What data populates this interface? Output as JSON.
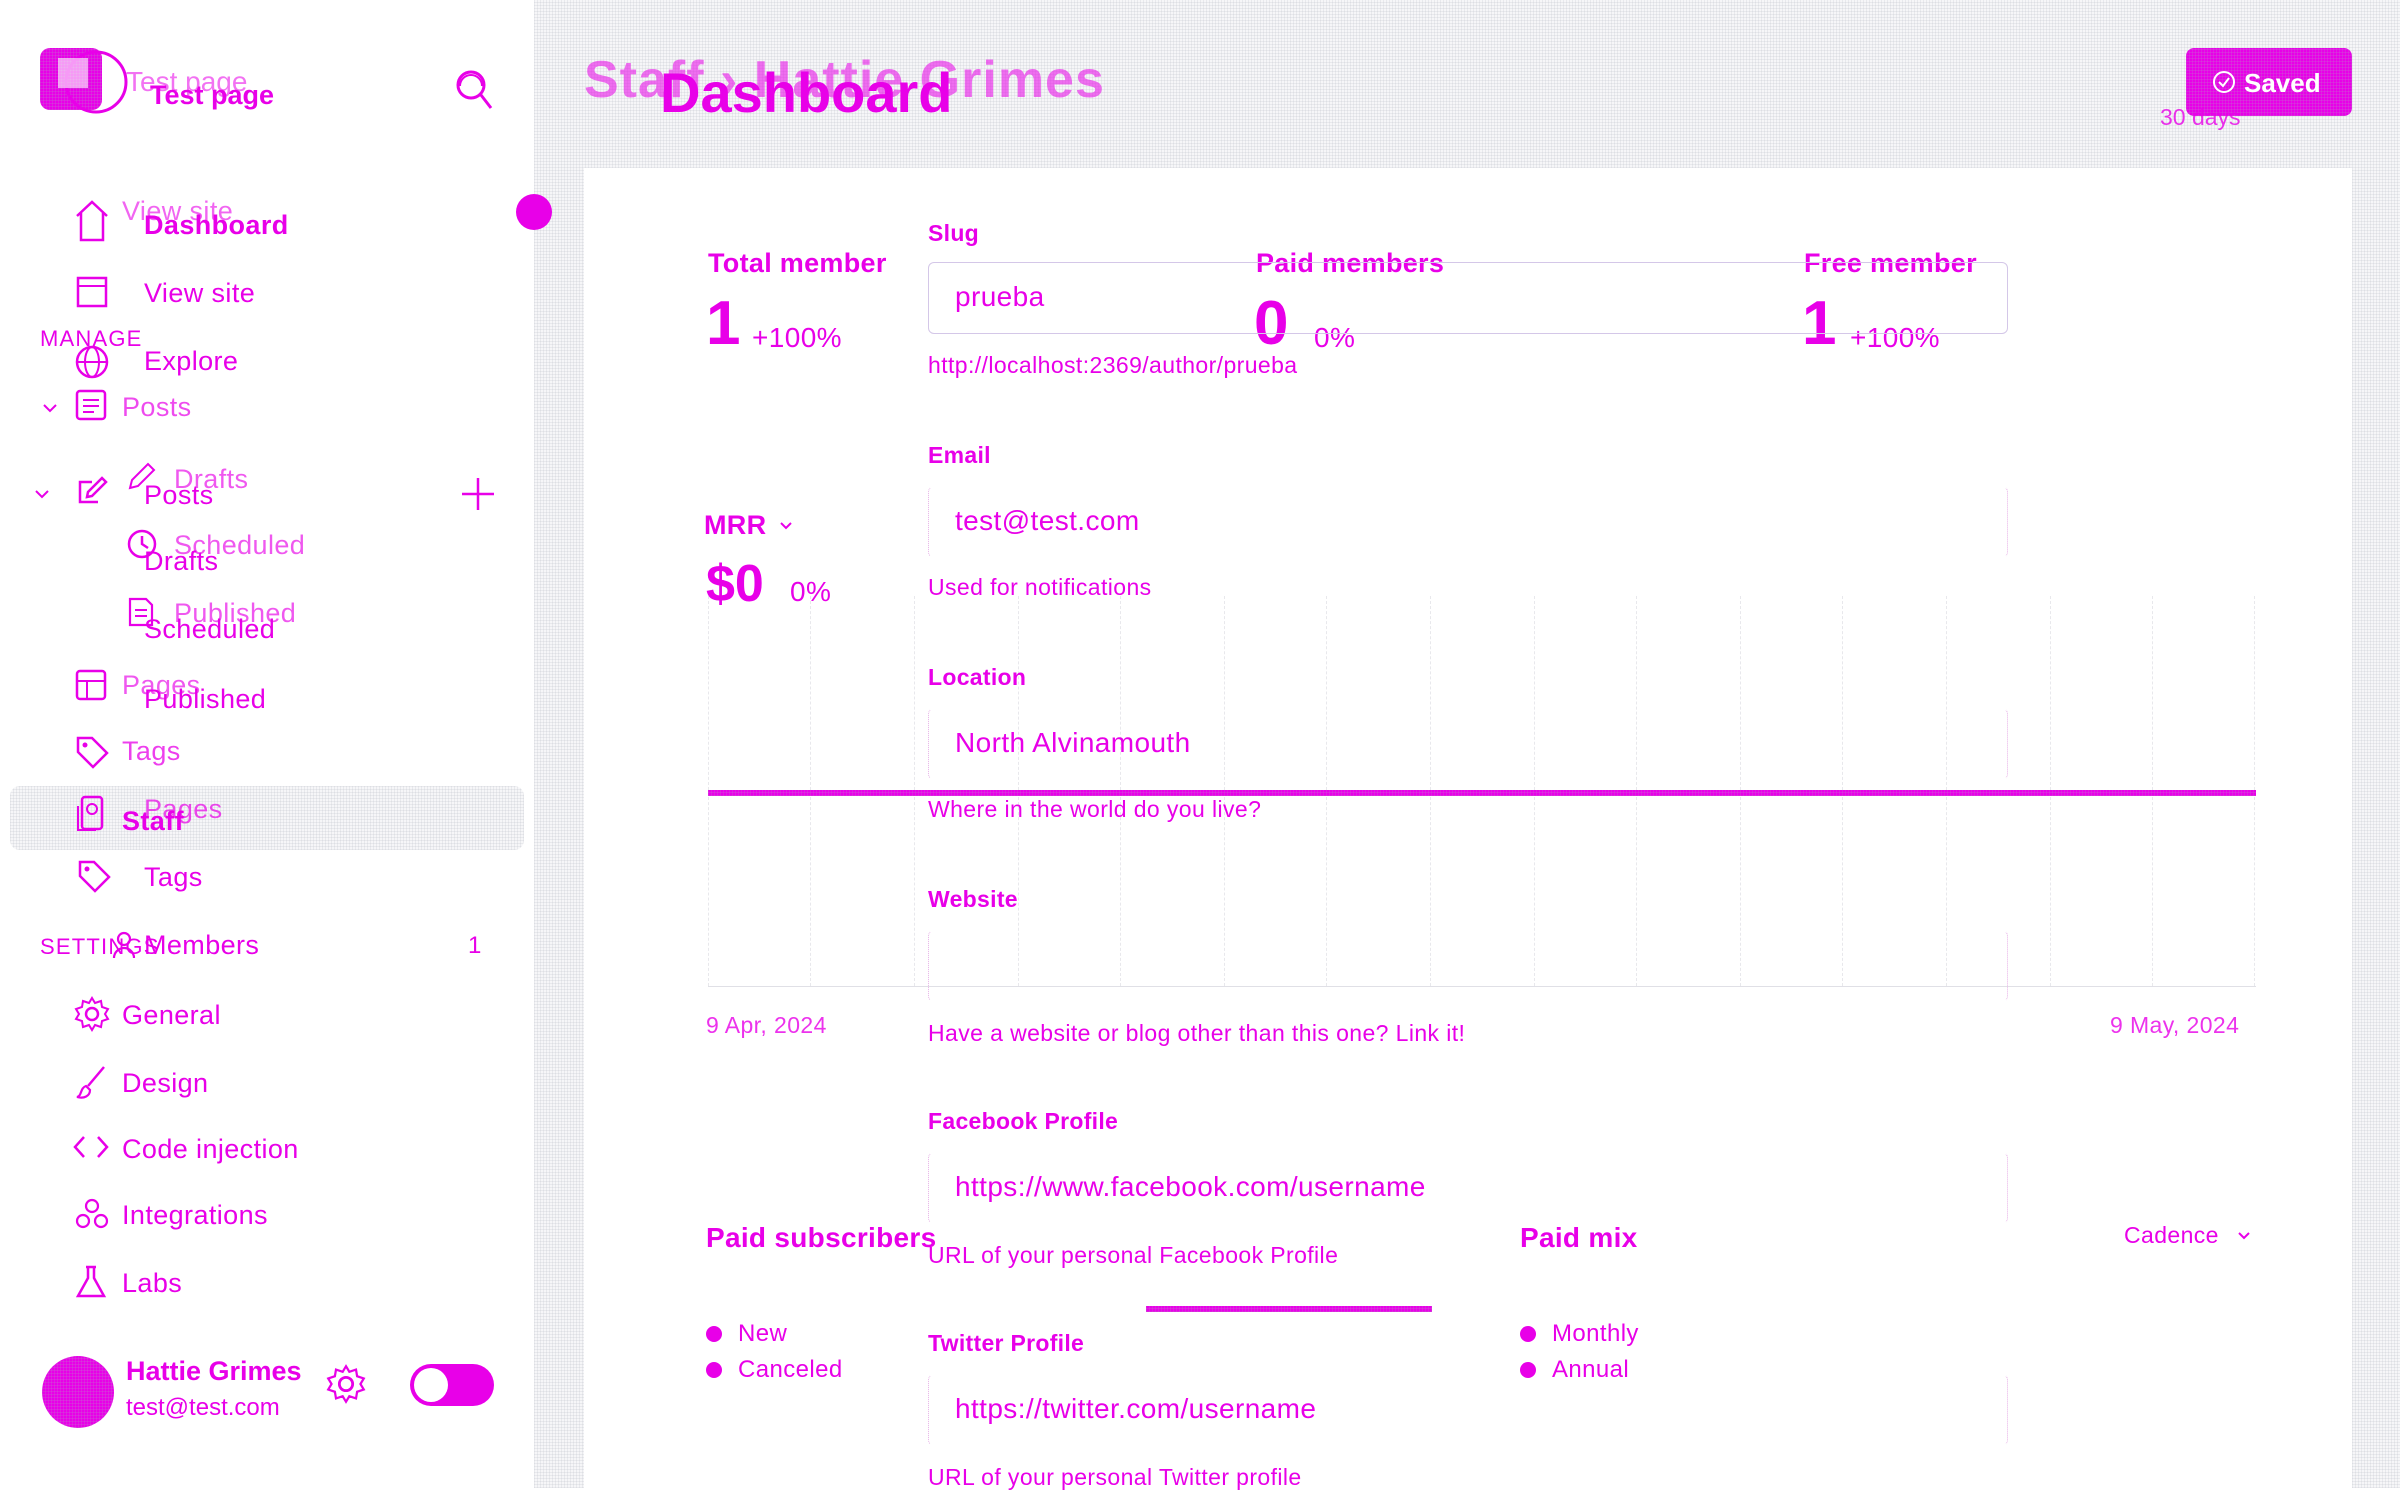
{
  "sidebar": {
    "site_title": "Test page",
    "site_title_ghost": "Test page",
    "nav": {
      "dashboard": "Dashboard",
      "view_site": "View site",
      "view_site_ghost": "View site",
      "explore": "Explore",
      "manage_header": "MANAGE",
      "posts": "Posts",
      "posts_ghost": "Posts",
      "drafts": "Drafts",
      "drafts_ghost": "Drafts",
      "scheduled": "Scheduled",
      "scheduled_ghost": "Scheduled",
      "published": "Published",
      "published_ghost": "Published",
      "pages": "Pages",
      "pages_ghost": "Pages",
      "tags": "Tags",
      "tags_ghost": "Tags",
      "staff": "Staff",
      "members": "Members",
      "members_count": "1",
      "settings_header": "SETTINGS",
      "general": "General",
      "design": "Design",
      "code_injection": "Code injection",
      "integrations": "Integrations",
      "labs": "Labs"
    },
    "user": {
      "name": "Hattie Grimes",
      "email": "test@test.com"
    }
  },
  "header": {
    "breadcrumb_title": "Staff  ›  Hattie Grimes",
    "dashboard_title": "Dashboard",
    "saved_button": "Saved",
    "range": "30 days"
  },
  "metrics": {
    "total_members_label": "Total member",
    "total_members_value": "1",
    "total_members_change": "+100%",
    "paid_members_label": "Paid members",
    "paid_members_value": "0",
    "paid_members_change": "0%",
    "free_members_label": "Free member",
    "free_members_value": "1",
    "free_members_change": "+100%",
    "mrr_label": "MRR",
    "mrr_value": "$0",
    "mrr_change": "0%",
    "date_start": "9 Apr, 2024",
    "date_end": "9 May, 2024"
  },
  "form": {
    "slug_label": "Slug",
    "slug_value": "prueba",
    "slug_url": "http://localhost:2369/author/prueba",
    "email_label": "Email",
    "email_value": "test@test.com",
    "email_hint": "Used for notifications",
    "location_label": "Location",
    "location_value": "North Alvinamouth",
    "location_hint": "Where in the world do you live?",
    "website_label": "Website",
    "website_value": "",
    "website_hint": "Have a website or blog other than this one? Link it!",
    "facebook_label": "Facebook Profile",
    "facebook_value": "https://www.facebook.com/username",
    "facebook_hint": "URL of your personal Facebook Profile",
    "twitter_label": "Twitter Profile",
    "twitter_value": "https://twitter.com/username",
    "twitter_hint": "URL of your personal Twitter profile"
  },
  "subscribers": {
    "paid_subscribers_label": "Paid subscribers",
    "legend_new": "New",
    "legend_canceled": "Canceled",
    "paid_mix_label": "Paid mix",
    "cadence_label": "Cadence",
    "legend_monthly": "Monthly",
    "legend_annual": "Annual"
  },
  "colors": {
    "accent": "#e800e8",
    "sidebar_active": "#eef0f3"
  }
}
